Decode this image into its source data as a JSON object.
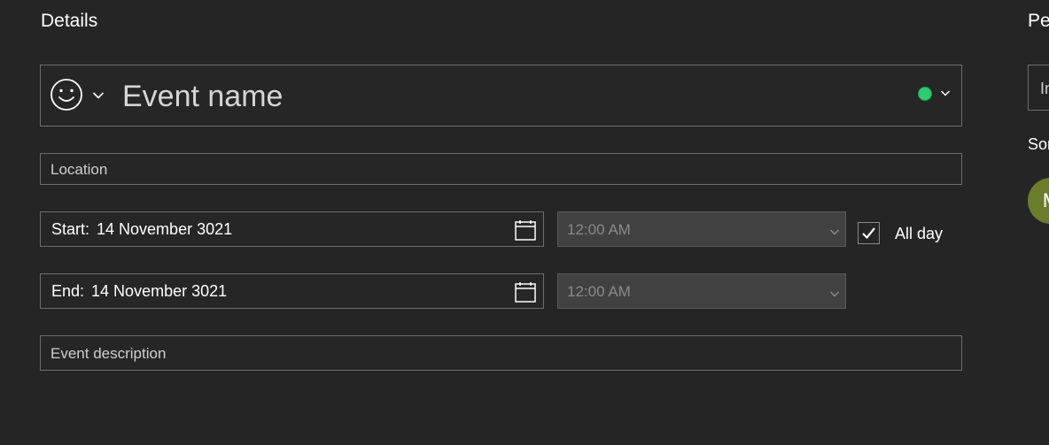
{
  "details": {
    "title": "Details",
    "event_name_placeholder": "Event name",
    "emoji_icon": "smiley-icon",
    "event_color": "#2ecc71",
    "location_placeholder": "Location",
    "start": {
      "label": "Start:",
      "date": "14 November 3021",
      "time": "12:00 AM"
    },
    "end": {
      "label": "End:",
      "date": "14 November 3021",
      "time": "12:00 AM"
    },
    "all_day": {
      "label": "All day",
      "checked": true
    },
    "description_placeholder": "Event description"
  },
  "people_panel": {
    "title": "Pe",
    "invite_text": "In",
    "sort_label": "Sor",
    "avatar_initial": "M",
    "avatar_color": "#6b7d2b"
  }
}
